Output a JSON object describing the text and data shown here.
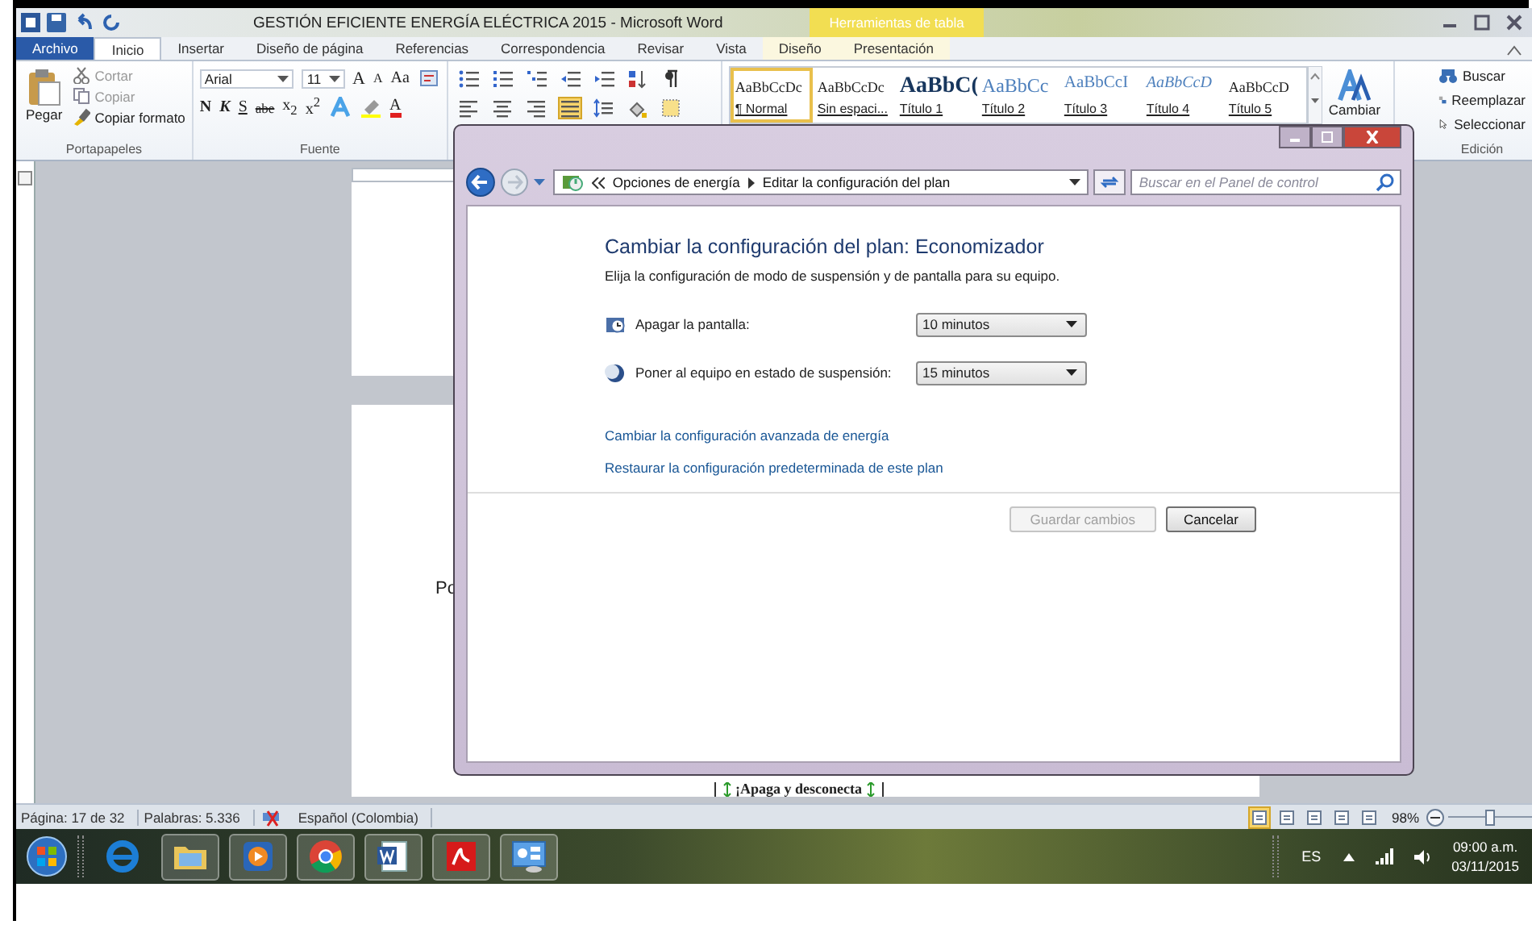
{
  "word": {
    "title": "GESTIÓN EFICIENTE ENERGÍA ELÉCTRICA 2015 - Microsoft Word",
    "contextual_tab": "Herramientas de tabla",
    "tabs": [
      {
        "label": "Archivo",
        "kind": "file",
        "selected": false
      },
      {
        "label": "Inicio",
        "kind": "tab",
        "selected": true
      },
      {
        "label": "Insertar",
        "kind": "tab",
        "selected": false
      },
      {
        "label": "Diseño de página",
        "kind": "tab",
        "selected": false
      },
      {
        "label": "Referencias",
        "kind": "tab",
        "selected": false
      },
      {
        "label": "Correspondencia",
        "kind": "tab",
        "selected": false
      },
      {
        "label": "Revisar",
        "kind": "tab",
        "selected": false
      },
      {
        "label": "Vista",
        "kind": "tab",
        "selected": false
      },
      {
        "label": "Diseño",
        "kind": "context",
        "selected": false
      },
      {
        "label": "Presentación",
        "kind": "context",
        "selected": false
      }
    ],
    "clipboard": {
      "paste": "Pegar",
      "label": "Portapapeles",
      "items": [
        {
          "kind": "cut",
          "label": "Cortar",
          "disabled": true
        },
        {
          "kind": "copy",
          "label": "Copiar",
          "disabled": true
        },
        {
          "kind": "brush",
          "label": "Copiar formato",
          "disabled": false
        }
      ]
    },
    "font": {
      "name": "Arial",
      "size": "11",
      "label": "Fuente",
      "row1": [
        {
          "kind": "grow",
          "label": "A"
        },
        {
          "kind": "shrink",
          "label": "A"
        },
        {
          "kind": "case",
          "label": "Aa"
        },
        {
          "kind": "clear"
        }
      ],
      "row2": [
        {
          "kind": "bold",
          "label": "N"
        },
        {
          "kind": "italic",
          "label": "K"
        },
        {
          "kind": "underline",
          "label": "S"
        },
        {
          "kind": "strike",
          "label": "abe"
        },
        {
          "kind": "sub",
          "label": "x$_{2}$"
        },
        {
          "kind": "sup",
          "label": "x$^{2}$"
        },
        {
          "kind": "effects"
        },
        {
          "kind": "highlight"
        },
        {
          "kind": "color",
          "label": "A"
        }
      ]
    },
    "paragraph": {
      "row1": [
        {
          "kind": "bullets"
        },
        {
          "kind": "numbering"
        },
        {
          "kind": "multilevel"
        },
        {
          "kind": "outdent"
        },
        {
          "kind": "indent"
        },
        {
          "kind": "sort"
        },
        {
          "kind": "pilcrow"
        }
      ],
      "row2": [
        {
          "kind": "left",
          "selected": false
        },
        {
          "kind": "center",
          "selected": false
        },
        {
          "kind": "right",
          "selected": false
        },
        {
          "kind": "justify",
          "selected": true
        },
        {
          "kind": "spacing",
          "selected": false
        },
        {
          "kind": "shading",
          "selected": false
        },
        {
          "kind": "borders",
          "selected": false
        }
      ]
    },
    "styles": [
      {
        "sample": "AaBbCcDc",
        "name": "¶ Normal",
        "kind": "plain",
        "selected": true
      },
      {
        "sample": "AaBbCcDc",
        "name": "Sin espaci...",
        "kind": "plain",
        "selected": false
      },
      {
        "sample": "AaBbC(",
        "name": "Título 1",
        "kind": "h1",
        "selected": false
      },
      {
        "sample": "AaBbCc",
        "name": "Título 2",
        "kind": "h2",
        "selected": false
      },
      {
        "sample": "AaBbCcI",
        "name": "Título 3",
        "kind": "h3",
        "selected": false
      },
      {
        "sample": "AaBbCcD",
        "name": "Título 4",
        "kind": "h4",
        "selected": false
      },
      {
        "sample": "AaBbCcD",
        "name": "Título 5",
        "kind": "plain",
        "selected": false
      }
    ],
    "change_styles": "Cambiar",
    "editing": {
      "label": "Edición",
      "items": [
        {
          "kind": "find",
          "label": "Buscar"
        },
        {
          "kind": "replace",
          "label": "Reemplazar"
        },
        {
          "kind": "select",
          "label": "Seleccionar"
        }
      ]
    },
    "document": {
      "fragment": "Po",
      "cell_text": "¡Apaga y desconecta"
    },
    "status_bar": {
      "page": "Página: 17 de 32",
      "words": "Palabras: 5.336",
      "language": "Español (Colombia)",
      "zoom": "98%",
      "zoom_level": {
        "level": 0.5
      },
      "views": [
        {
          "selected": true
        },
        {
          "selected": false
        },
        {
          "selected": false
        },
        {
          "selected": false
        },
        {
          "selected": false
        }
      ]
    }
  },
  "dialog": {
    "breadcrumb": [
      "Opciones de energía",
      "Editar la configuración del plan"
    ],
    "search_placeholder": "Buscar en el Panel de control",
    "heading": "Cambiar la configuración del plan: Economizador",
    "description": "Elija la configuración de modo de suspensión y de pantalla para su equipo.",
    "settings": [
      {
        "kind": "display",
        "label": "Apagar la pantalla:",
        "value": "10 minutos"
      },
      {
        "kind": "sleep",
        "label": "Poner al equipo en estado de suspensión:",
        "value": "15 minutos"
      }
    ],
    "links": [
      "Cambiar la configuración avanzada de energía",
      "Restaurar la configuración predeterminada de este plan"
    ],
    "buttons": [
      {
        "label": "Guardar cambios",
        "disabled": true
      },
      {
        "label": "Cancelar",
        "disabled": false
      }
    ]
  },
  "taskbar": {
    "apps": [
      {
        "kind": "ie",
        "running": false
      },
      {
        "kind": "folder",
        "running": true
      },
      {
        "kind": "media",
        "running": true
      },
      {
        "kind": "chrome",
        "running": true
      },
      {
        "kind": "word",
        "running": true
      },
      {
        "kind": "pdf",
        "running": true
      },
      {
        "kind": "control",
        "running": true
      }
    ],
    "language": "ES",
    "time": "09:00 a.m.",
    "date": "03/11/2015"
  }
}
